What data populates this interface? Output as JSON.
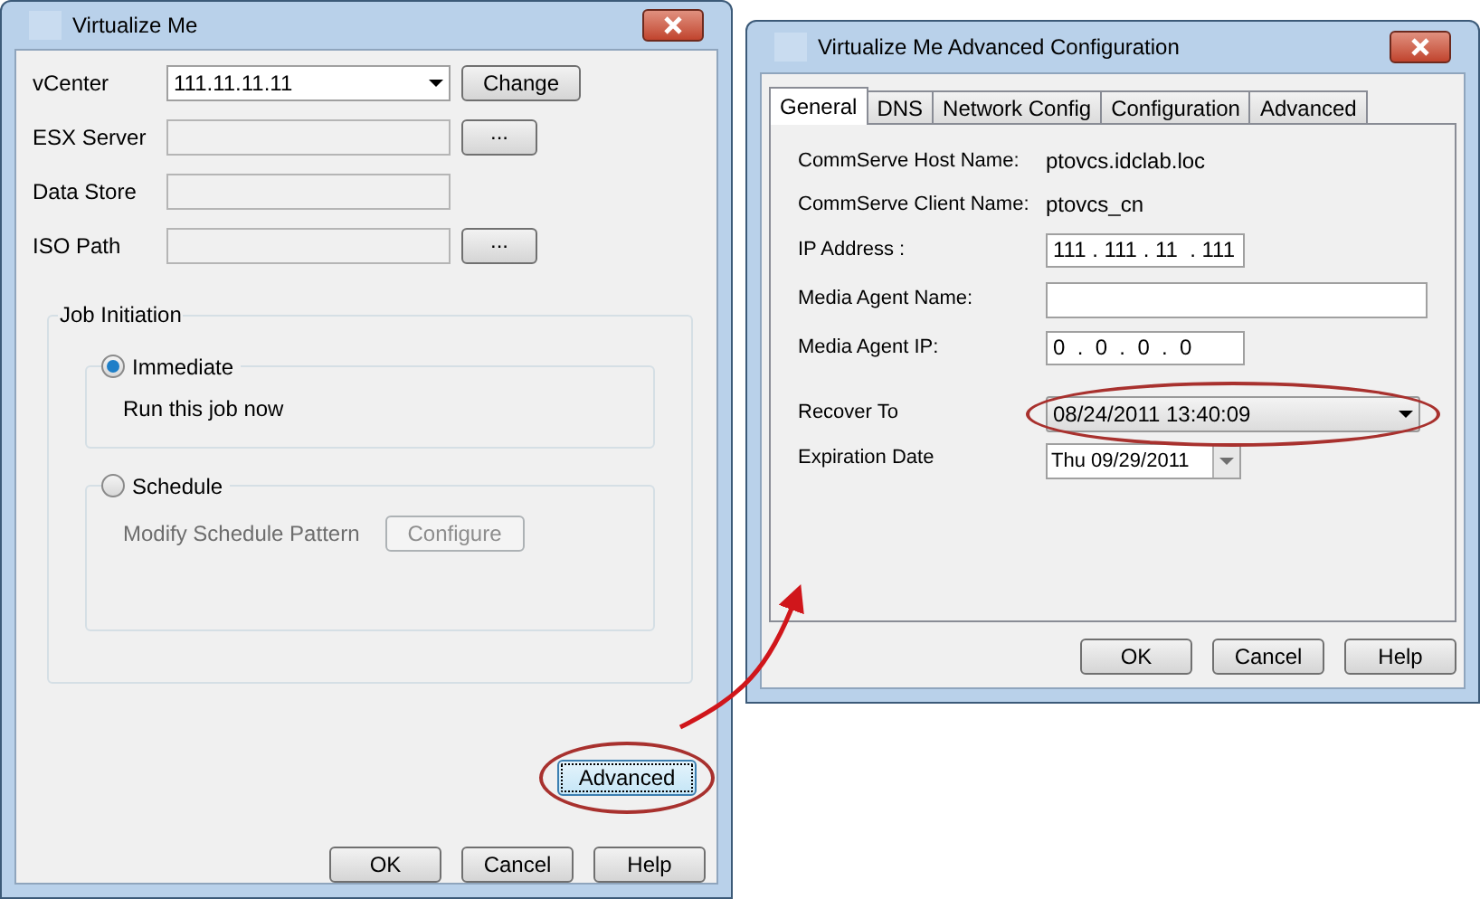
{
  "left_window": {
    "title": "Virtualize Me",
    "fields": [
      {
        "label": "vCenter",
        "kind": "combo",
        "value": "111.11.11.11",
        "disabled": false,
        "button": "Change"
      },
      {
        "label": "ESX Server",
        "kind": "text",
        "disabled": true,
        "button": "..."
      },
      {
        "label": "Data Store",
        "kind": "text",
        "disabled": true
      },
      {
        "label": "ISO Path",
        "kind": "text",
        "disabled": true,
        "button": "..."
      }
    ],
    "job_initiation": {
      "title": "Job Initiation",
      "options": [
        {
          "label": "Immediate",
          "selected": true,
          "description": "Run this job now"
        },
        {
          "label": "Schedule",
          "selected": false,
          "description": "Modify Schedule Pattern",
          "button": "Configure"
        }
      ]
    },
    "advanced_button": {
      "label": "Advanced",
      "highlighted": true
    },
    "buttons": [
      "OK",
      "Cancel",
      "Help"
    ]
  },
  "right_window": {
    "title": "Virtualize Me Advanced Configuration",
    "tabs": [
      {
        "label": "General",
        "selected": true
      },
      {
        "label": "DNS",
        "selected": false
      },
      {
        "label": "Network Config",
        "selected": false
      },
      {
        "label": "Configuration",
        "selected": false
      },
      {
        "label": "Advanced",
        "selected": false
      }
    ],
    "rows": [
      {
        "kind": "info",
        "label": "CommServe Host Name:",
        "value": "ptovcs.idclab.loc"
      },
      {
        "kind": "info",
        "label": "CommServe Client Name:",
        "value": "ptovcs_cn"
      },
      {
        "kind": "ip",
        "label": "IP Address :",
        "value": "111 . 111 . 11  . 111"
      },
      {
        "kind": "text",
        "label": "Media Agent Name:"
      },
      {
        "kind": "ip",
        "label": "Media Agent IP:",
        "value": "0  .  0  .  0  .  0"
      },
      {
        "kind": "combo",
        "label": "Recover To",
        "value": "08/24/2011 13:40:09",
        "highlighted": true
      },
      {
        "kind": "date",
        "label": "Expiration Date",
        "value": "Thu 09/29/2011"
      }
    ],
    "buttons": [
      "OK",
      "Cancel",
      "Help"
    ]
  }
}
